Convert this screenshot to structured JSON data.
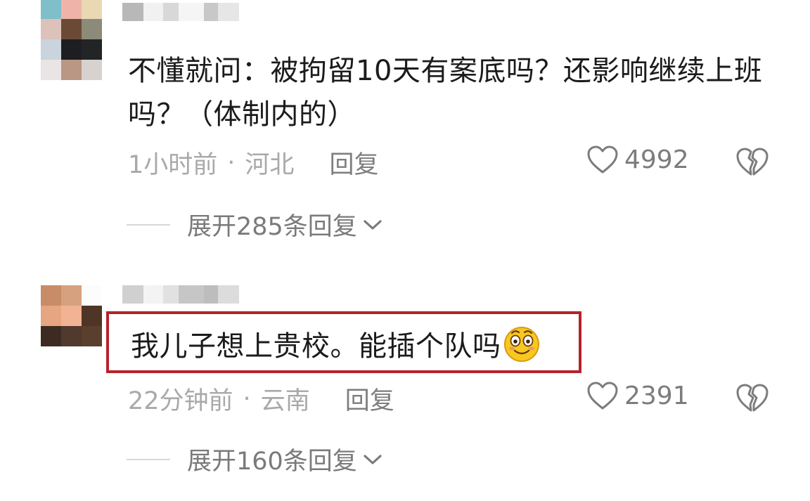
{
  "comments": [
    {
      "text": "不懂就问：被拘留10天有案底吗？还影响继续上班吗？（体制内的）",
      "time": "1小时前",
      "location": "河北",
      "separator": "·",
      "reply_label": "回复",
      "likes": "4992",
      "expand_label": "展开285条回复",
      "avatar_colors": [
        "#7fbfc9",
        "#f0b3a9",
        "#ead8b3",
        "#dcc2ba",
        "#6b4a35",
        "#8c8a79",
        "#c9d4dc",
        "#1d1e21",
        "#222425",
        "#e8e5e4",
        "#b99784",
        "#d7d2ce"
      ],
      "username_colors": [
        "#b8b8b8",
        "#f1f1f1",
        "#d8d8d8",
        "#f5f5f5",
        "#c8c8c8",
        "#e6e6e6"
      ]
    },
    {
      "text": "我儿子想上贵校。能插个队吗",
      "emoji": "smiling-face-emoji",
      "time": "22分钟前",
      "location": "云南",
      "separator": "·",
      "reply_label": "回复",
      "likes": "2391",
      "expand_label": "展开160条回复",
      "avatar_colors": [
        "#c88c68",
        "#d6a17f",
        "#fcfcfc",
        "#e7a581",
        "#f2b394",
        "#4e3525",
        "#3d2b21",
        "#51392e",
        "#5a3e2e"
      ],
      "username_colors": [
        "#d0d0d0",
        "#f3f3f3",
        "#e1e1e1",
        "#c6c6c6",
        "#bdbdbd",
        "#dcdcdc"
      ]
    }
  ],
  "colors": {
    "highlight_border": "#b6222b",
    "meta_text": "#a9a9a9",
    "action_text": "#7a7a7a"
  }
}
